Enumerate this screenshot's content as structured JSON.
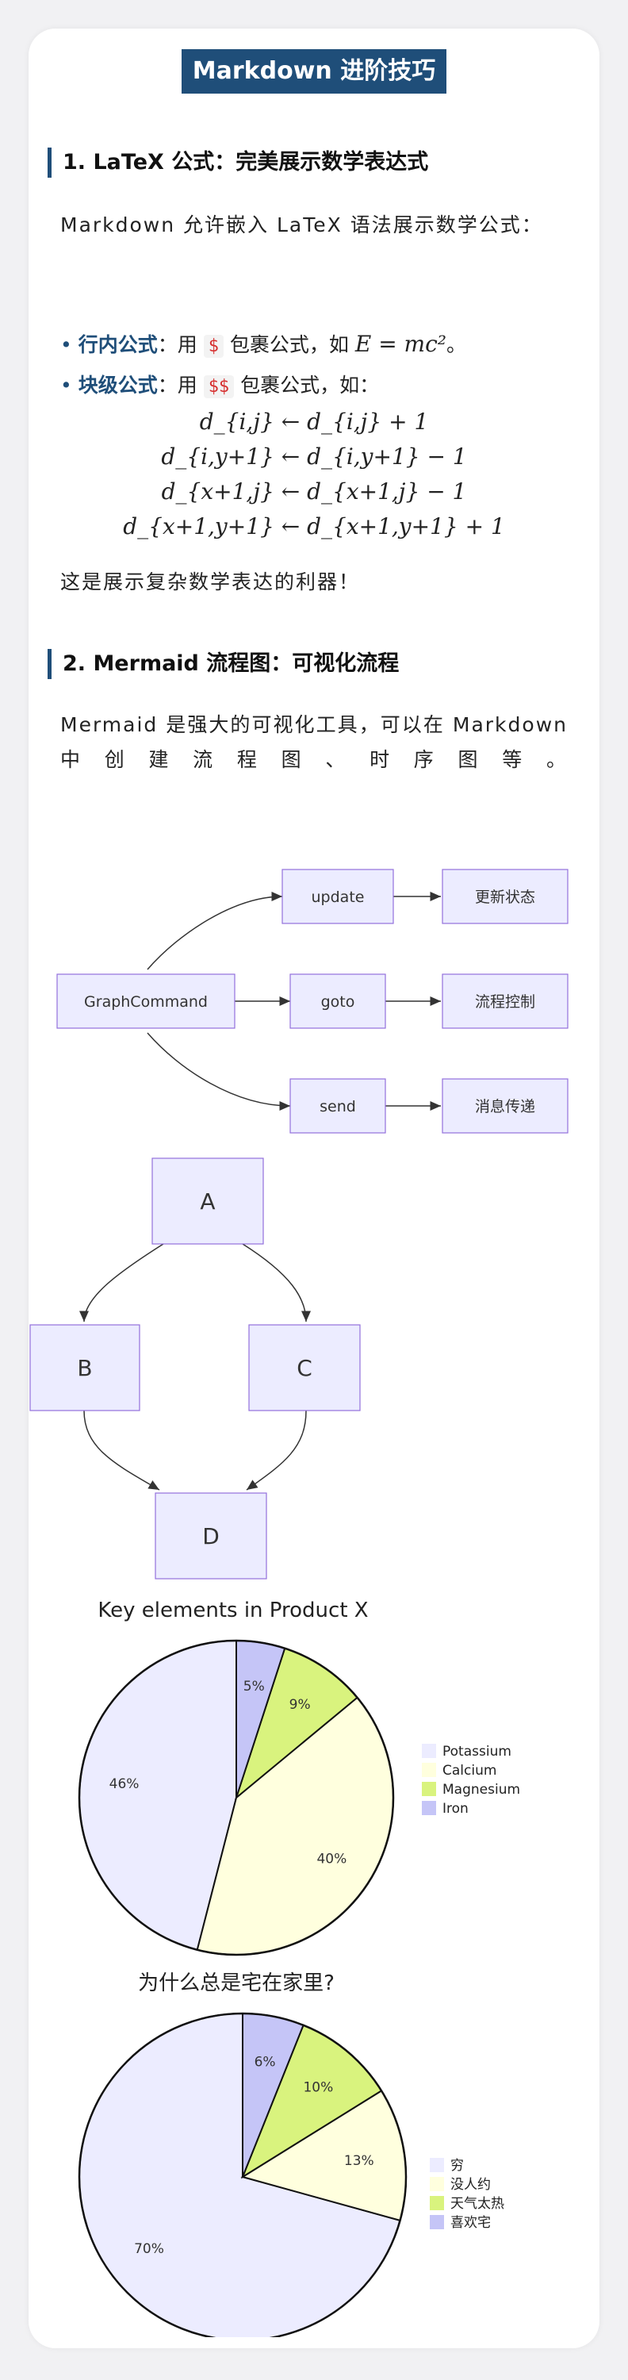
{
  "title": "Markdown 进阶技巧",
  "section1": {
    "heading": "1. LaTeX 公式：完美展示数学表达式",
    "intro": "Markdown 允许嵌入 LaTeX 语法展示数学公式：",
    "bullet_inline": {
      "label": "行内公式",
      "pre": "：用",
      "code": "$",
      "post": "包裹公式，如",
      "formula": "E = mc²",
      "end": "。"
    },
    "bullet_block": {
      "label": "块级公式",
      "pre": "：用",
      "code": "$$",
      "post": "包裹公式，如："
    },
    "equations": [
      "d_{i,j} ← d_{i,j} + 1",
      "d_{i,y+1} ← d_{i,y+1} − 1",
      "d_{x+1,j} ← d_{x+1,j} − 1",
      "d_{x+1,y+1} ← d_{x+1,y+1} + 1"
    ],
    "closing": "这是展示复杂数学表达的利器！"
  },
  "section2": {
    "heading": "2. Mermaid 流程图：可视化流程",
    "intro": "Mermaid 是强大的可视化工具，可以在 Markdown 中创建流程图、时序图等。"
  },
  "flow1": {
    "root": "GraphCommand",
    "nodes": [
      "update",
      "goto",
      "send"
    ],
    "targets": [
      "更新状态",
      "流程控制",
      "消息传递"
    ]
  },
  "flow2": {
    "nodes": [
      "A",
      "B",
      "C",
      "D"
    ]
  },
  "colors": {
    "accent": "#1f4e79",
    "node_fill": "#ececff",
    "node_stroke": "#9370db"
  },
  "chart_data": [
    {
      "type": "pie",
      "title": "Key elements in Product X",
      "categories": [
        "Potassium",
        "Calcium",
        "Magnesium",
        "Iron"
      ],
      "values": [
        46,
        40,
        9,
        5
      ],
      "labels": [
        "46%",
        "40%",
        "9%",
        "5%"
      ],
      "colors": [
        "#ececff",
        "#ffffde",
        "#d9f37e",
        "#c5c5f7"
      ],
      "legend": "right"
    },
    {
      "type": "pie",
      "title": "为什么总是宅在家里?",
      "categories": [
        "穷",
        "没人约",
        "天气太热",
        "喜欢宅"
      ],
      "values": [
        70,
        13,
        10,
        6
      ],
      "labels": [
        "70%",
        "13%",
        "10%",
        "6%"
      ],
      "colors": [
        "#ececff",
        "#ffffde",
        "#d9f37e",
        "#c5c5f7"
      ],
      "legend": "right"
    }
  ]
}
